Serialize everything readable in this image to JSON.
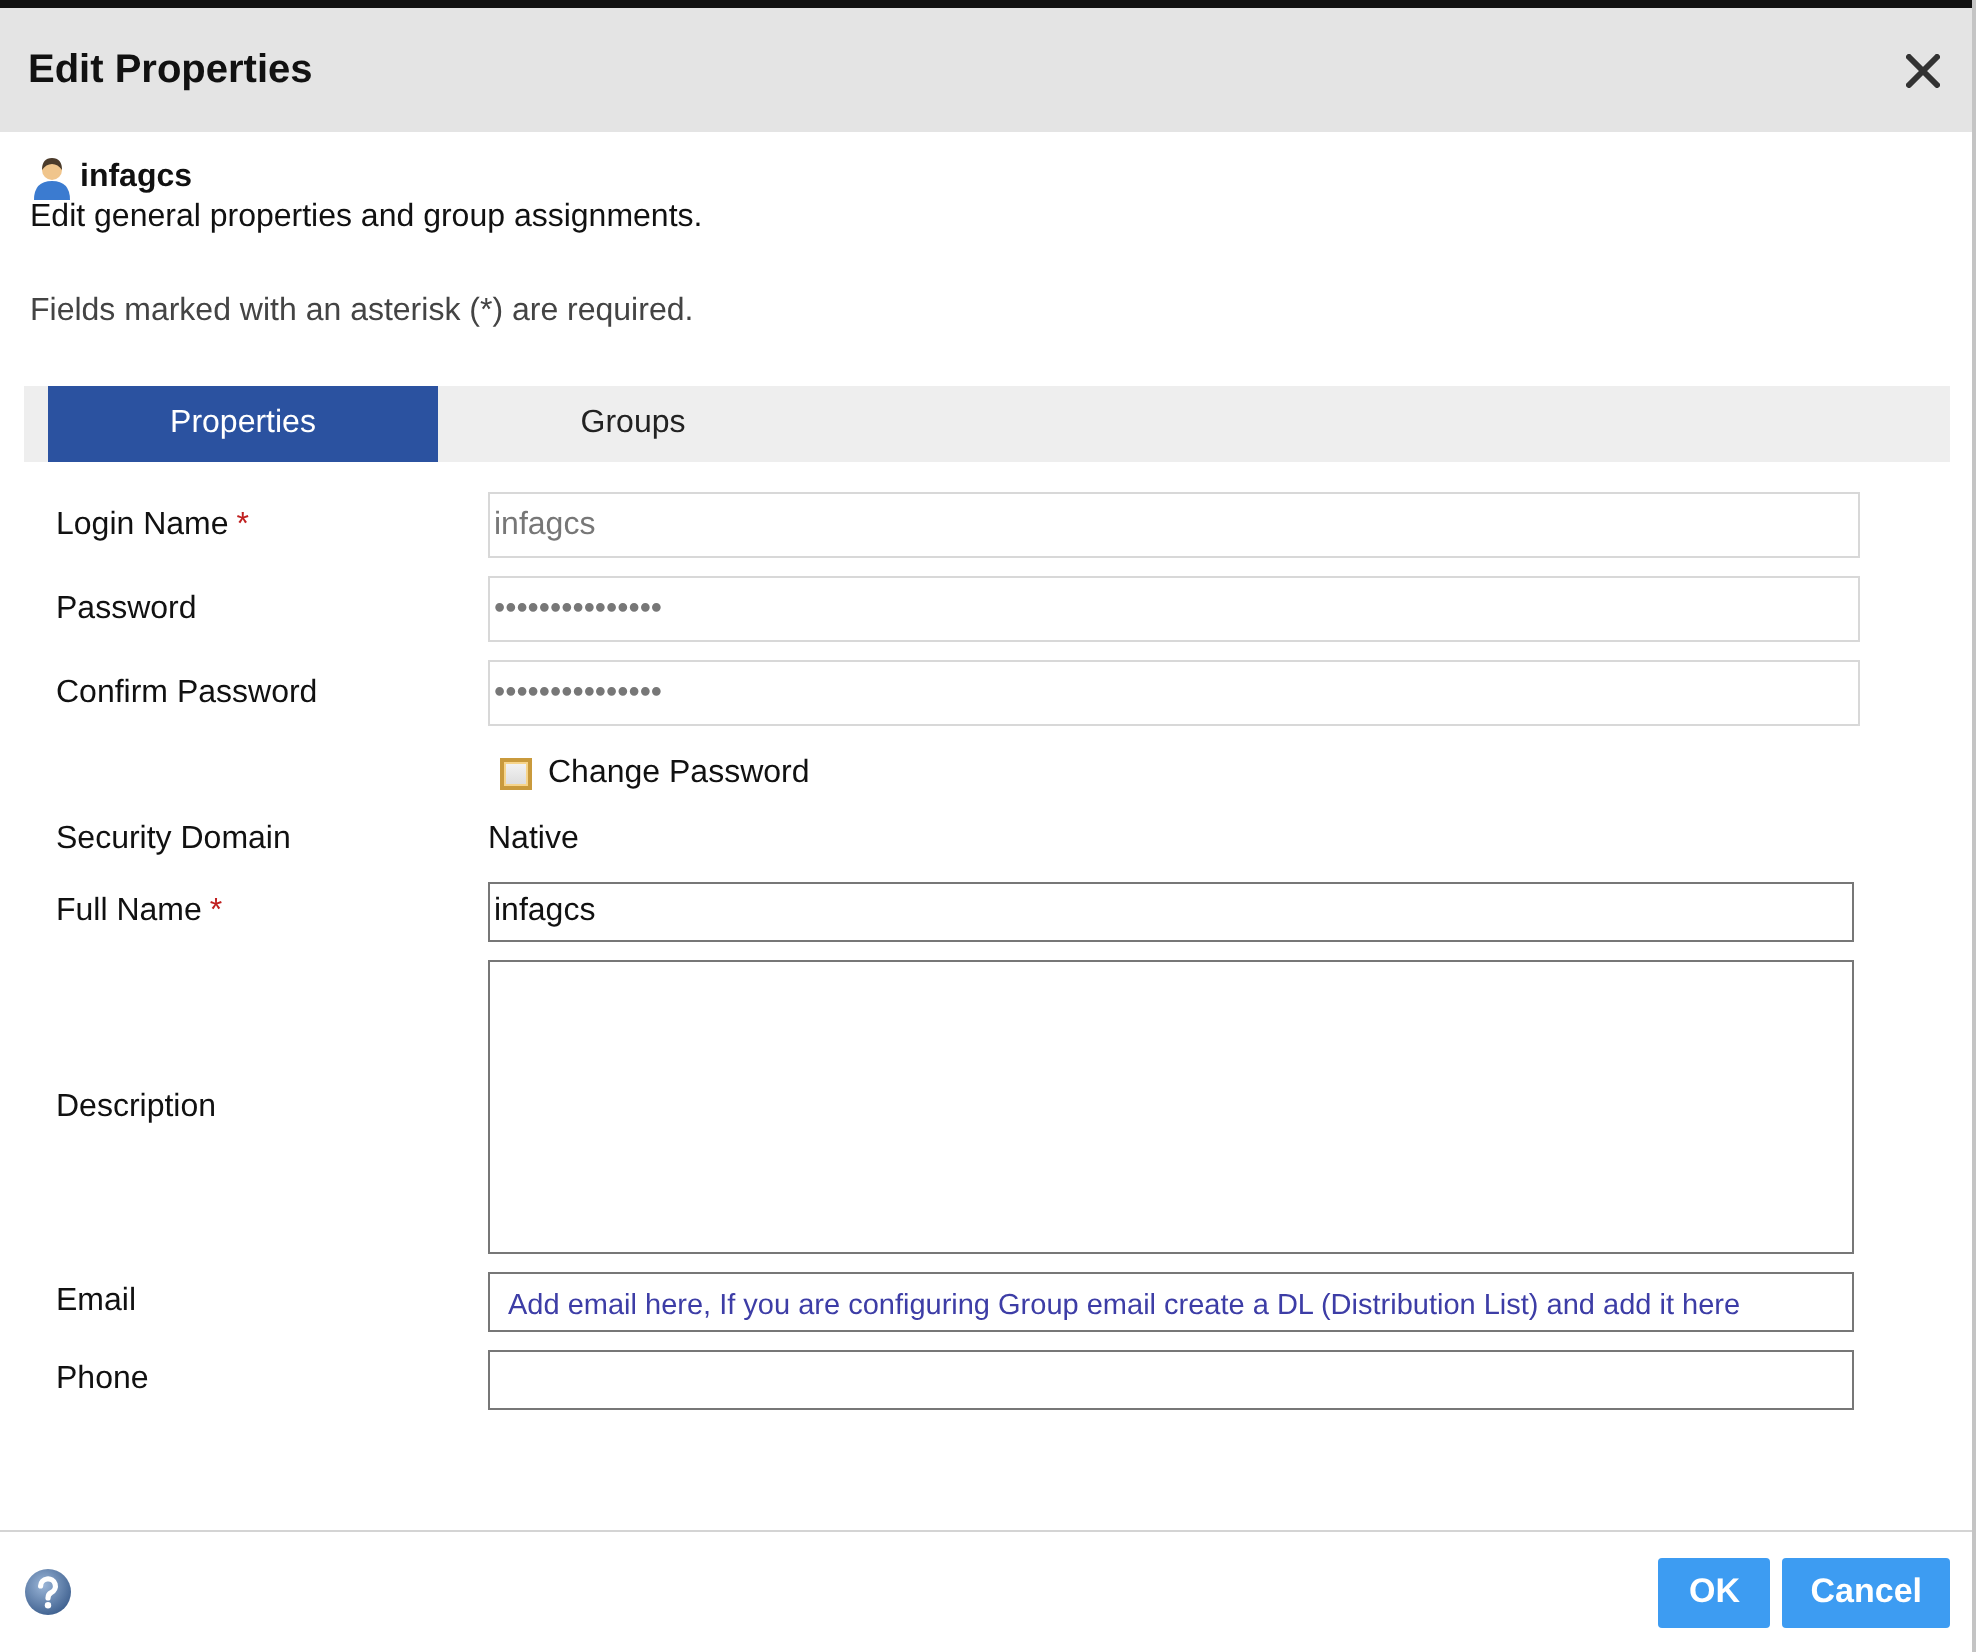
{
  "dialog": {
    "title": "Edit Properties"
  },
  "user": {
    "name": "infagcs",
    "description": "Edit general properties and group assignments."
  },
  "required_note": "Fields marked with an asterisk (*) are required.",
  "tabs": [
    {
      "label": "Properties",
      "selected": true
    },
    {
      "label": "Groups",
      "selected": false
    }
  ],
  "fields": [
    {
      "kind": "input",
      "label": "Login Name",
      "required_mark": "*",
      "disabled": true,
      "value": "infagcs"
    },
    {
      "kind": "input",
      "label": "Password",
      "disabled": true,
      "value": "•••••••••••••••"
    },
    {
      "kind": "input",
      "label": "Confirm Password",
      "disabled": true,
      "value": "•••••••••••••••",
      "checkbox": {
        "text": "Change Password",
        "checked": false
      }
    },
    {
      "kind": "text",
      "label": "Security Domain",
      "value": "Native"
    },
    {
      "kind": "input",
      "label": "Full Name",
      "required_mark": "*",
      "disabled": false,
      "value": "infagcs"
    },
    {
      "kind": "textarea",
      "label": "Description",
      "disabled": false
    },
    {
      "kind": "input",
      "label": "Email",
      "disabled": false,
      "annotation": "Add email here, If you are configuring Group email create a DL (Distribution List) and add it here"
    },
    {
      "kind": "input",
      "label": "Phone",
      "disabled": false
    }
  ],
  "buttons": [
    {
      "label": "OK"
    },
    {
      "label": "Cancel"
    }
  ]
}
